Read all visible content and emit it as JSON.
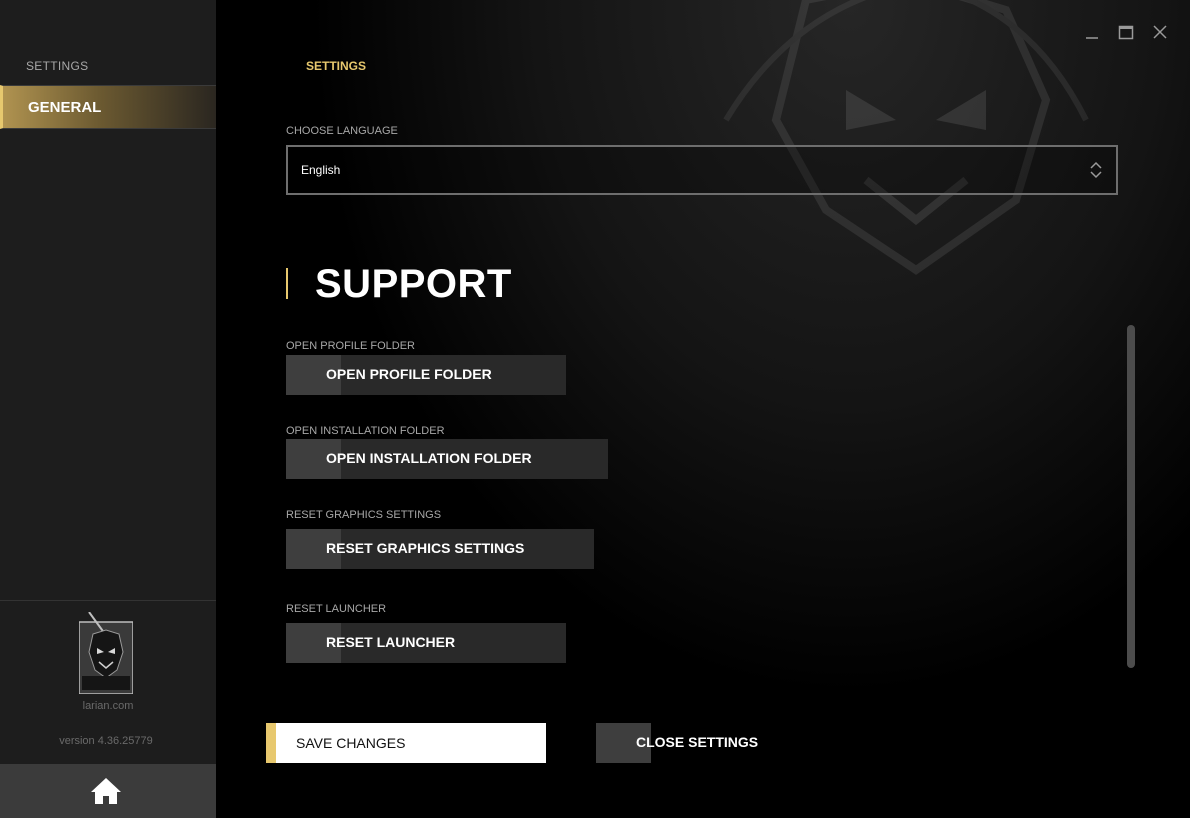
{
  "sidebar": {
    "title": "SETTINGS",
    "items": [
      {
        "label": "GENERAL",
        "active": true
      }
    ],
    "logo_text": "LARIAN STUDIOS",
    "url": "larian.com",
    "version": "version 4.36.25779",
    "home_icon": "home-icon"
  },
  "header": {
    "tab": "SETTINGS",
    "window_controls": [
      "minimize-icon",
      "maximize-icon",
      "close-icon"
    ]
  },
  "language": {
    "label": "CHOOSE LANGUAGE",
    "value": "English"
  },
  "support": {
    "title": "SUPPORT",
    "actions": [
      {
        "label": "OPEN PROFILE FOLDER",
        "button": "OPEN PROFILE FOLDER"
      },
      {
        "label": "OPEN INSTALLATION FOLDER",
        "button": "OPEN INSTALLATION FOLDER"
      },
      {
        "label": "RESET GRAPHICS SETTINGS",
        "button": "RESET GRAPHICS SETTINGS"
      },
      {
        "label": "RESET LAUNCHER",
        "button": "RESET LAUNCHER"
      }
    ]
  },
  "footer": {
    "save": "SAVE CHANGES",
    "close": "CLOSE SETTINGS"
  },
  "colors": {
    "accent": "#e7c86e",
    "sidebar_bg": "#1d1d1d",
    "button_bg": "#292929"
  }
}
